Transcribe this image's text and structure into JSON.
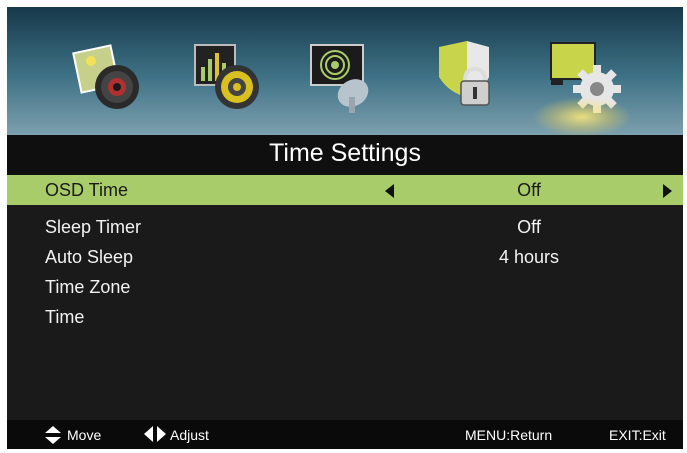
{
  "menu": {
    "icons": [
      {
        "name": "picture-icon"
      },
      {
        "name": "sound-icon"
      },
      {
        "name": "channel-icon"
      },
      {
        "name": "lock-icon"
      },
      {
        "name": "time-settings-icon",
        "selected": true
      }
    ],
    "title": "Time Settings"
  },
  "rows": [
    {
      "label": "OSD Time",
      "value": "Off",
      "selected": true
    },
    {
      "label": "Sleep Timer",
      "value": "Off"
    },
    {
      "label": "Auto Sleep",
      "value": "4 hours"
    },
    {
      "label": "Time Zone",
      "value": ""
    },
    {
      "label": "Time",
      "value": ""
    }
  ],
  "footer": {
    "move_label": "Move",
    "adjust_label": "Adjust",
    "menu_label": "MENU:Return",
    "exit_label": "EXIT:Exit"
  },
  "colors": {
    "selected_row": "#a9cc6a",
    "background": "#1a1a1a"
  }
}
